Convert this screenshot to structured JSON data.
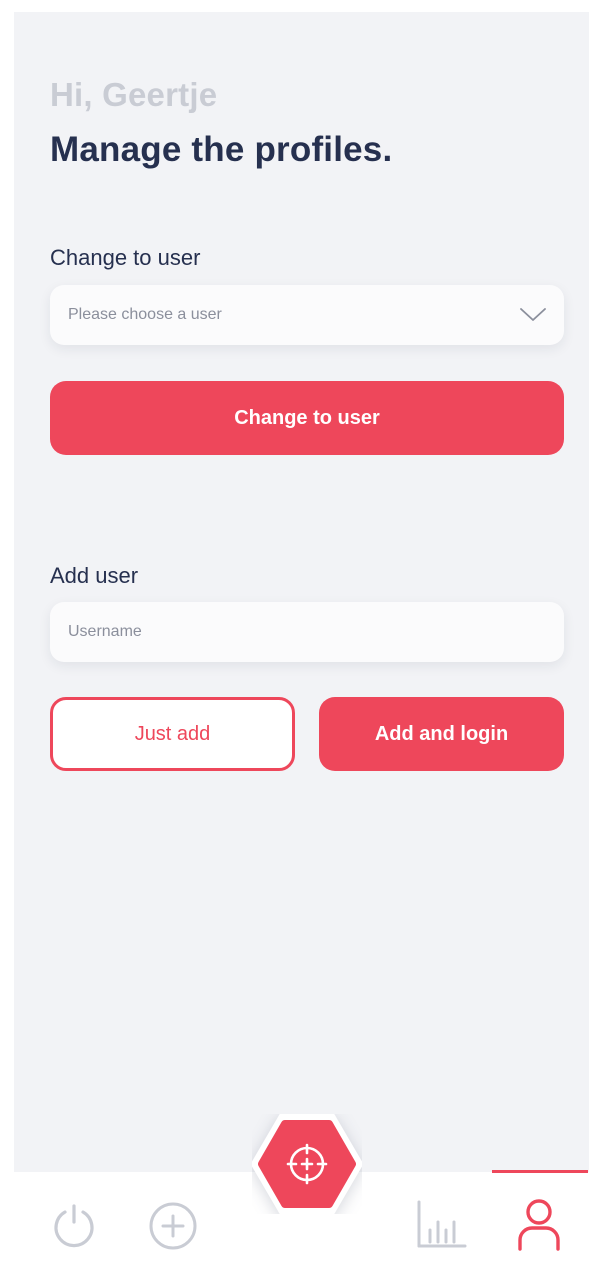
{
  "header": {
    "greeting": "Hi, Geertje",
    "title": "Manage the profiles."
  },
  "change_user": {
    "label": "Change to user",
    "select_placeholder": "Please choose a user",
    "button_label": "Change to user"
  },
  "add_user": {
    "label": "Add user",
    "input_placeholder": "Username",
    "input_value": "",
    "just_add_label": "Just add",
    "add_login_label": "Add and login"
  },
  "tabbar": {
    "active_tab": "profile",
    "icons": [
      "power-icon",
      "add-circle-icon",
      "target-icon",
      "bar-chart-icon",
      "user-icon"
    ]
  },
  "colors": {
    "accent": "#ee475b",
    "text_dark": "#26304f",
    "text_muted": "#c9ccd4",
    "background": "#f2f3f6"
  }
}
